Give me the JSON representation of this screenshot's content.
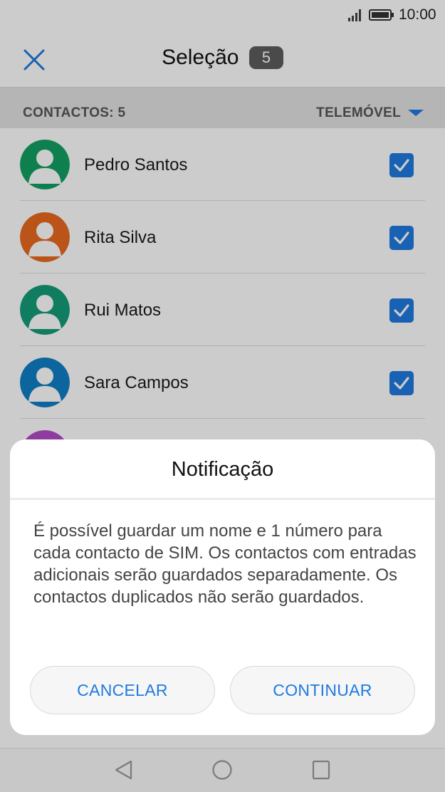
{
  "status_bar": {
    "time": "10:00"
  },
  "header": {
    "title": "Seleção",
    "selected_count": "5"
  },
  "section": {
    "count_label": "CONTACTOS: 5",
    "filter_label": "TELEMÓVEL"
  },
  "contacts": [
    {
      "name": "Pedro Santos",
      "avatar_color": "#12a063",
      "checked": true
    },
    {
      "name": "Rita Silva",
      "avatar_color": "#e96a1f",
      "checked": true
    },
    {
      "name": "Rui Matos",
      "avatar_color": "#149c78",
      "checked": true
    },
    {
      "name": "Sara Campos",
      "avatar_color": "#0f7fc3",
      "checked": true
    },
    {
      "name": "",
      "avatar_color": "#b24bc7",
      "checked": true
    }
  ],
  "dialog": {
    "title": "Notificação",
    "message": "É possível guardar um nome e 1 número para cada contacto de SIM. Os contactos com entradas adicionais serão guardados separadamente. Os contactos duplicados não serão guardados.",
    "cancel_label": "CANCELAR",
    "continue_label": "CONTINUAR"
  },
  "colors": {
    "accent": "#1f7ae0",
    "badge": "#5d5d5d"
  },
  "icons": {
    "close": "close-icon",
    "signal": "signal-icon",
    "battery": "battery-icon",
    "filter": "caret-down-icon",
    "nav_back": "back-icon",
    "nav_home": "home-icon",
    "nav_recent": "recent-apps-icon"
  }
}
